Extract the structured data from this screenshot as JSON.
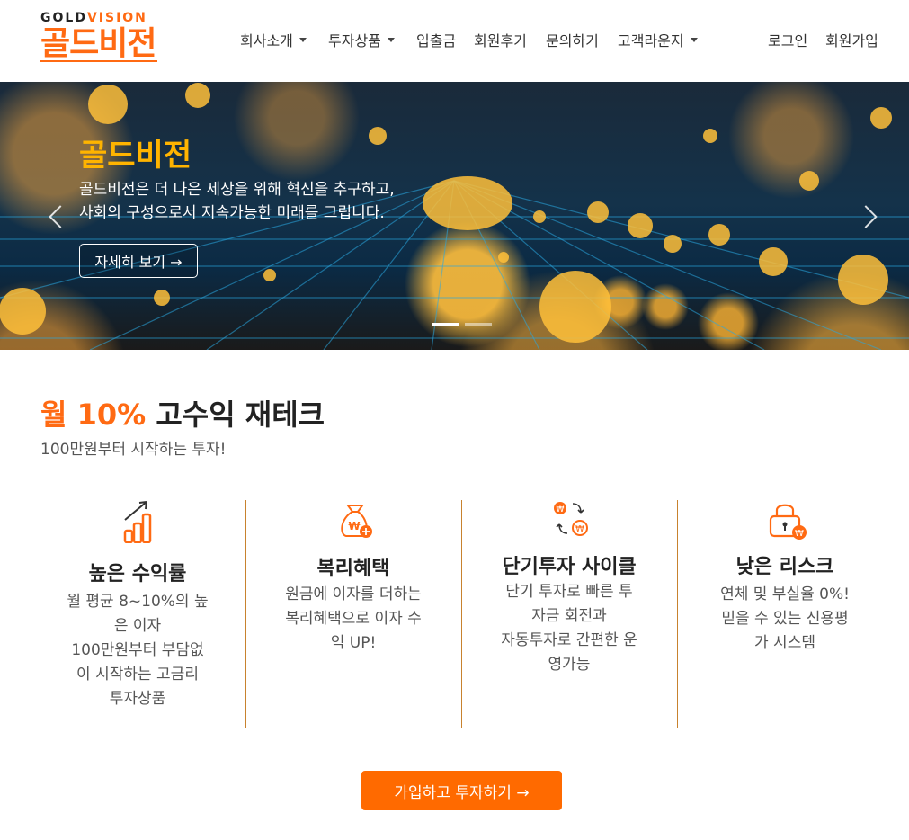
{
  "header": {
    "logo_en_gold": "GOLD",
    "logo_en_vision": "VISION",
    "logo_ko": "골드비전",
    "nav": [
      {
        "label": "회사소개",
        "dropdown": true
      },
      {
        "label": "투자상품",
        "dropdown": true
      },
      {
        "label": "입출금",
        "dropdown": false
      },
      {
        "label": "회원후기",
        "dropdown": false
      },
      {
        "label": "문의하기",
        "dropdown": false
      },
      {
        "label": "고객라운지",
        "dropdown": true
      }
    ],
    "login": "로그인",
    "signup": "회원가입"
  },
  "hero": {
    "title": "골드비전",
    "line1": "골드비전은 더 나은 세상을 위해 혁신을 추구하고,",
    "line2": "사회의 구성으로서 지속가능한 미래를 그립니다.",
    "button": "자세히 보기 →",
    "active_slide": 1,
    "slide_count": 2
  },
  "section": {
    "headline_accent": "월 10%",
    "headline_rest": " 고수익 재테크",
    "subline": "100만원부터 시작하는 투자!"
  },
  "features": [
    {
      "icon": "chart-growth-icon",
      "title": "높은 수익률",
      "desc": [
        "월 평균 8~10%의 높",
        "은 이자",
        "100만원부터 부담없",
        "이 시작하는 고금리",
        "투자상품"
      ]
    },
    {
      "icon": "money-bag-icon",
      "title": "복리혜택",
      "desc": [
        "원금에 이자를 더하는",
        "복리혜택으로 이자 수",
        "익 UP!"
      ]
    },
    {
      "icon": "currency-cycle-icon",
      "title": "단기투자 사이클",
      "desc": [
        "단기 투자로 빠른 투",
        "자금 회전과",
        "자동투자로 간편한 운",
        "영가능"
      ]
    },
    {
      "icon": "lock-icon",
      "title": "낮은 리스크",
      "desc": [
        "연체 및 부실율 0%!",
        "믿을 수 있는 신용평",
        "가 시스템"
      ]
    }
  ],
  "cta": {
    "label": "가입하고 투자하기 →"
  },
  "colors": {
    "accent": "#ff6a13",
    "gold": "#ffb400",
    "divider": "#c8822e"
  }
}
